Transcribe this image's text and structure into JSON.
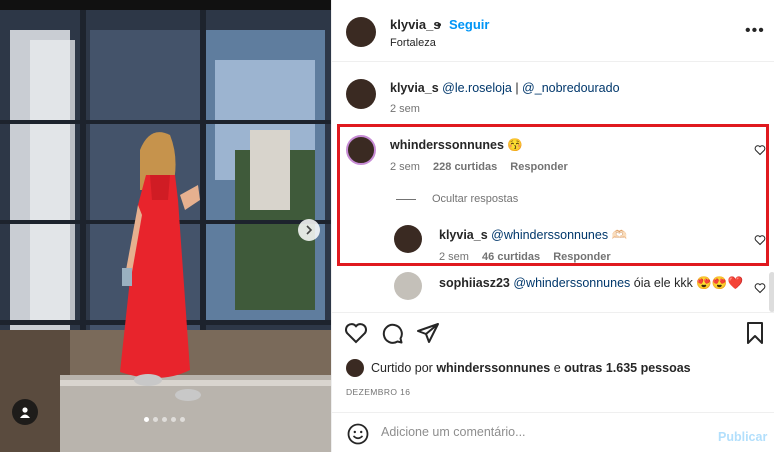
{
  "post": {
    "username": "klyvia_s",
    "separator": "•",
    "follow_label": "Seguir",
    "location": "Fortaleza"
  },
  "caption": {
    "username": "klyvia_s",
    "mention1": "@le.roseloja",
    "divider": "|",
    "mention2": "@_nobredourado",
    "time": "2 sem"
  },
  "comments": [
    {
      "username": "whinderssonnunes",
      "text": "😚",
      "time": "2 sem",
      "likes": "228 curtidas",
      "reply": "Responder",
      "hide_replies": "Ocultar respostas",
      "replies": [
        {
          "username": "klyvia_s",
          "mention": "@whinderssonnunes",
          "text": "🫶🏻",
          "time": "2 sem",
          "likes": "46 curtidas",
          "reply": "Responder"
        }
      ]
    },
    {
      "username": "sophiiasz23",
      "mention": "@whinderssonnunes",
      "text": "óia ele kkk 😍😍❤️"
    }
  ],
  "likes": {
    "prefix": "Curtido por",
    "user": "whinderssonnunes",
    "middle": "e",
    "others": "outras 1.635 pessoas"
  },
  "date": "DEZEMBRO 16",
  "add_comment": {
    "placeholder": "Adicione um comentário...",
    "publish_label": "Publicar"
  },
  "carousel": {
    "total": 5,
    "current": 1
  },
  "icons": [
    "heart-icon",
    "comment-icon",
    "share-icon",
    "save-icon",
    "emoji-icon",
    "more-options-icon",
    "user-tag-icon",
    "next-arrow-icon"
  ],
  "colors": {
    "accent": "#0095f6",
    "highlight": "#e0191f",
    "dress": "#e8242c"
  }
}
